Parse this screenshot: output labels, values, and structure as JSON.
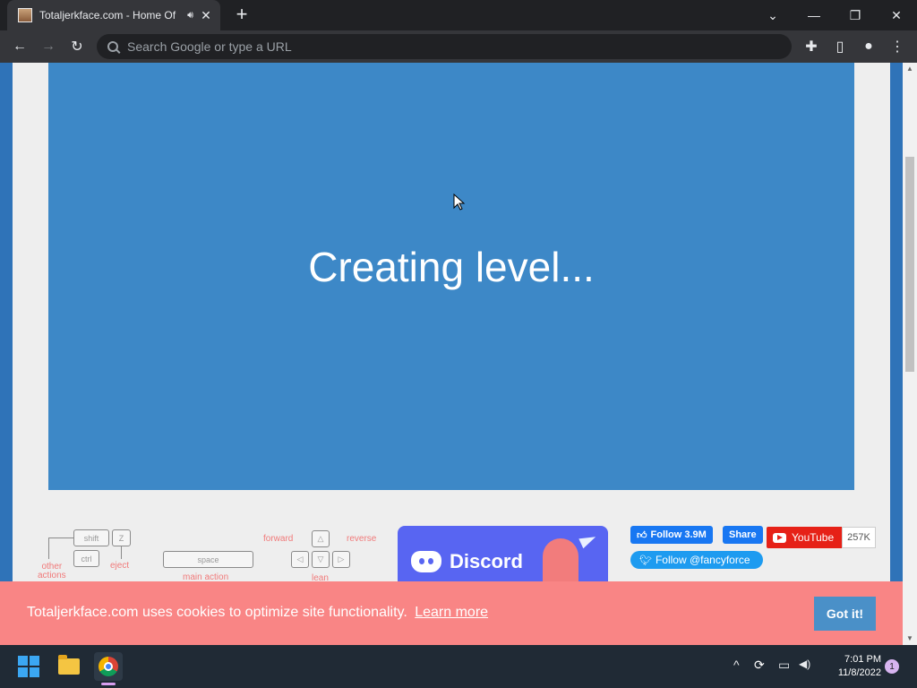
{
  "browser": {
    "tab_title": "Totaljerkface.com - Home Of",
    "audio_icon": "speaker-icon",
    "close_glyph": "✕",
    "newtab_glyph": "+",
    "omnibox_placeholder": "Search Google or type a URL",
    "window_controls": {
      "tab_search": "⌄",
      "minimize": "—",
      "restore": "❐",
      "close": "✕"
    },
    "toolbar": {
      "back": "←",
      "forward": "→",
      "reload": "↻",
      "extensions": "✚",
      "side_panel": "▯",
      "profile": "●",
      "menu": "⋮"
    }
  },
  "game": {
    "loading_text": "Creating level..."
  },
  "controls": {
    "keys": {
      "shift": "shift",
      "z": "Z",
      "ctrl": "ctrl",
      "space": "space",
      "up": "△",
      "down": "▽",
      "left": "◁",
      "right": "▷"
    },
    "labels": {
      "other_actions": "other\nactions",
      "eject": "eject",
      "main_action": "main action",
      "forward": "forward",
      "reverse": "reverse",
      "lean": "lean"
    }
  },
  "discord": {
    "label": "Discord"
  },
  "social": {
    "fb_follow": "Follow 3.9M",
    "fb_share": "Share",
    "youtube_label": "YouTube",
    "youtube_count": "257K",
    "twitter_follow": "Follow @fancyforce"
  },
  "cookie": {
    "message": "Totaljerkface.com uses cookies to optimize site functionality.",
    "learn_more": "Learn more",
    "button": "Got it!"
  },
  "taskbar": {
    "time": "7:01 PM",
    "date": "11/8/2022",
    "notification_count": "1",
    "tray_icons": {
      "chevron": "^",
      "sync": "⟳",
      "network": "▭",
      "volume": "◀)"
    }
  },
  "colors": {
    "game_bg": "#3d88c7",
    "cookie_bg": "#f98585",
    "discord": "#5865f2",
    "facebook": "#1877f2",
    "youtube": "#e62117",
    "twitter": "#1d9bf0"
  }
}
